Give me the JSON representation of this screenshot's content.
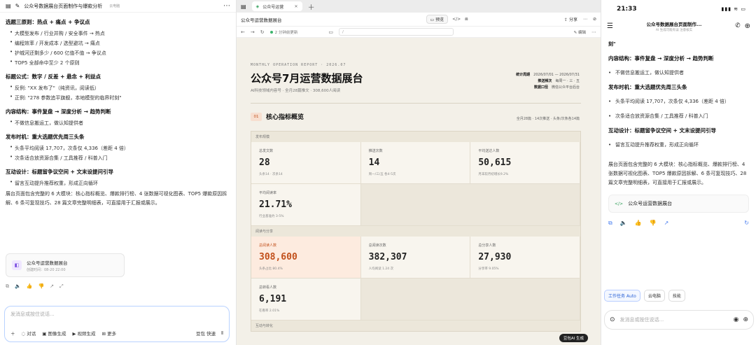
{
  "left": {
    "title": "公众号数据展台页面制作与爆款分析",
    "subtitle": "云电脑",
    "sections": [
      {
        "heading": "选题三原则：热点 + 痛点 + 争议点",
        "items": [
          "大模型发布 / 行业并购 / 安全事件 → 热点",
          "编程效率 / 开发成本 / 选型避坑 → 痛点",
          "护城河还剩多少 / 600 亿值不值 → 争议点",
          "TOP5 全部命中至少 2 个原则"
        ]
      },
      {
        "heading": "标题公式：数字 / 反差 + 悬念 + 利益点",
        "items": [
          "反例: \"XX 发布了\"（纯资讯，阅读低）",
          "正例: \"278 参数追平旗舰，本地模型的临界时刻\""
        ]
      },
      {
        "heading": "内容结构：事件复盘 → 深度分析 → 趋势判断",
        "items": [
          "不做信息搬运工，做认知提供者"
        ]
      },
      {
        "heading": "发布时机：重大选题优先周三头条",
        "items": [
          "头条平均阅读 17,707，次条仅 4,336（差距 4 倍）",
          "次条适合放资源合集 / 工具推荐 / 科普入门"
        ]
      },
      {
        "heading": "互动设计：标题留争议空间 + 文末设提问引导",
        "items": [
          "留言互动提升推荐权重，形成正向循环"
        ]
      }
    ],
    "summary": "展台页面包含完整的 6 大模块：核心指标概览、爆款排行榜、4 张数据可视化图表、TOP5 爆款原因拆解、6 条可复现技巧、28 篇文章完整明细表，可直接用于汇报或展示。",
    "card": {
      "title": "公众号运营数据展台",
      "time": "创建时间：08-20 22:00"
    },
    "actions": [
      "⧉",
      "🔈",
      "👍",
      "👎",
      "↗",
      "⤢"
    ],
    "input": {
      "placeholder": "发消息或按住说话...",
      "tools": [
        "对话",
        "图像生成",
        "视频生成",
        "更多"
      ],
      "model": "豆包 快速"
    }
  },
  "middle": {
    "tab": "公众号运营",
    "doc_name": "公众号运营数据展台",
    "preview_label": "预览",
    "share_label": "分享",
    "updated": "2 分钟前更新",
    "address": "/",
    "edit_label": "编辑",
    "page": {
      "eyebrow": "MONTHLY OPERATION REPORT · 2026.07",
      "title": "公众号7月运营数据展台",
      "subtitle": "AI科技领域内容号 · 全月28篇推文 · 308,600人阅读",
      "meta": [
        {
          "k": "统计周期",
          "v": "2026/07/01 — 2026/07/31"
        },
        {
          "k": "推送频次",
          "v": "每周一 · 三 · 五"
        },
        {
          "k": "数据口径",
          "v": "微信公众平台后台"
        }
      ],
      "section_num": "01",
      "section_title": "核心指标概览",
      "section_note": "全月28篇 · 14次推送 · 头条/次条各14篇",
      "groups": [
        {
          "label": "发布规模",
          "cells": [
            {
              "k": "总发文数",
              "v": "28",
              "n": "头条14 · 次条14"
            },
            {
              "k": "推送次数",
              "v": "14",
              "n": "周一/三/五 各4-5次"
            },
            {
              "k": "平均送达人数",
              "v": "50,615",
              "n": "月末较月初增长9.2%"
            },
            {
              "k": "平均阅读率",
              "v": "21.71%",
              "n": "行业基准约 3-5%"
            }
          ]
        },
        {
          "label": "阅读与分享",
          "cells": [
            {
              "k": "总阅读人数",
              "v": "308,600",
              "n": "头条占比 80.4%",
              "hl": true
            },
            {
              "k": "总阅读次数",
              "v": "382,307",
              "n": "人均阅读 1.24 次"
            },
            {
              "k": "总分享人数",
              "v": "27,930",
              "n": "分享率 9.05%"
            },
            {
              "k": "总转看人数",
              "v": "6,191",
              "n": "在看率 2.01%"
            }
          ]
        }
      ],
      "next_label": "互动与转化",
      "badge": "豆包AI 生成"
    }
  },
  "right": {
    "time": "21:33",
    "status_icons": "▮▮▮ ≋ ▭",
    "title": "公众号数据展台页面制作...",
    "subtitle": "AI 生成可能有误 注意核实",
    "quote_end": "刻\"",
    "sections": [
      {
        "heading": "内容结构：事件复盘 → 深度分析 → 趋势判断",
        "items": [
          "不做信息搬运工，做认知提供者"
        ]
      },
      {
        "heading": "发布时机：重大选题优先周三头条",
        "items": [
          "头条平均阅读 17,707，次条仅 4,336（差距 4 倍）",
          "次条适合放资源合集 / 工具推荐 / 科普入门"
        ]
      },
      {
        "heading": "互动设计：标题留争议空间 + 文末设提问引导",
        "items": [
          "留言互动提升推荐权重，形成正向循环"
        ]
      }
    ],
    "summary": "展台页面包含完整的 6 大模块：核心指标概览、爆款排行榜、4 张数据可视化图表、TOP5 爆款原因拆解、6 条可复现技巧、28 篇文章完整明细表，可直接用于汇报或展示。",
    "link_label": "公众号运营数据展台",
    "tools": [
      "工作任务 Auto",
      "云电脑",
      "技能"
    ],
    "input_placeholder": "发消息或按住说话..."
  }
}
